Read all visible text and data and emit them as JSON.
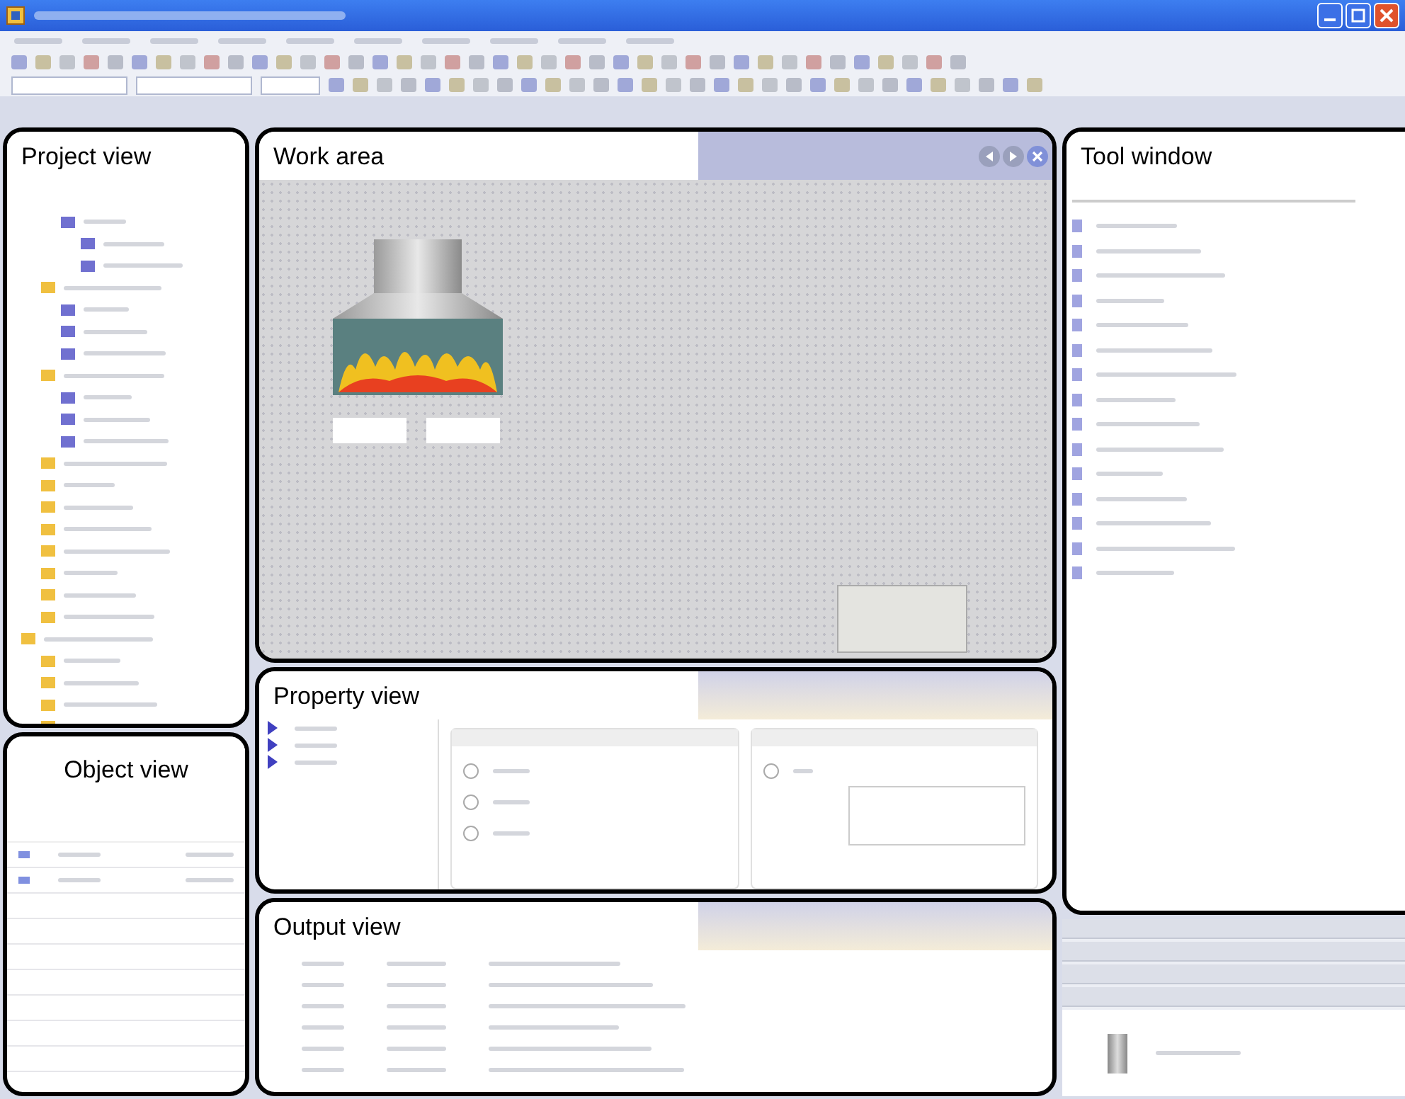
{
  "panels": [
    {
      "label": "Project view",
      "kind": "tree"
    },
    {
      "label": "Object view",
      "kind": "list"
    },
    {
      "label": "Work area",
      "kind": "canvas"
    },
    {
      "label": "Property view",
      "kind": "properties"
    },
    {
      "label": "Output view",
      "kind": "log"
    },
    {
      "label": "Tool window",
      "kind": "tools"
    }
  ]
}
